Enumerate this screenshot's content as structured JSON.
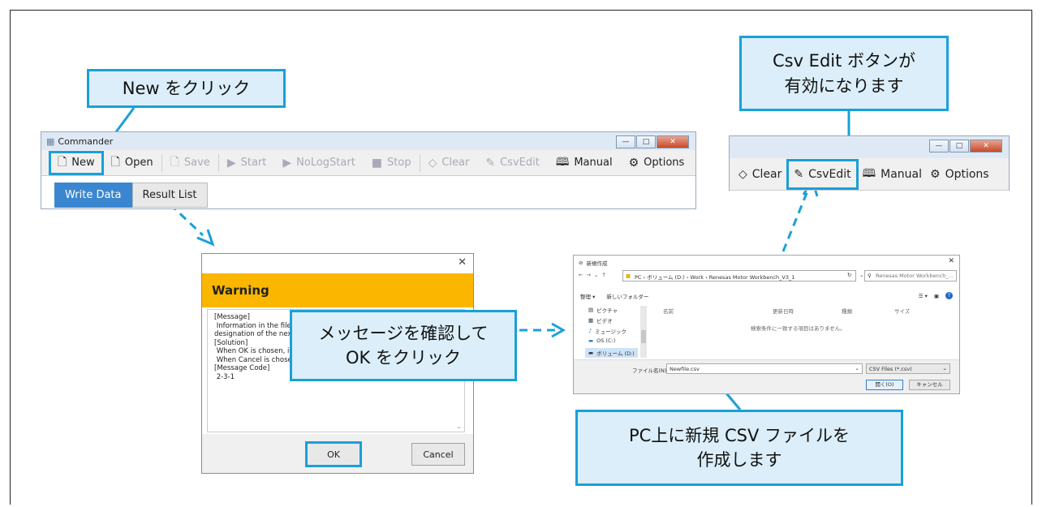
{
  "callouts": {
    "new_click": "New をクリック",
    "csvedit_enabled": "Csv Edit ボタンが\n有効になります",
    "confirm_ok": "メッセージを確認して\nOK をクリック",
    "create_csv": "PC上に新規 CSV ファイルを\n作成します"
  },
  "commander": {
    "title": "Commander",
    "toolbar": {
      "new": "New",
      "open": "Open",
      "save": "Save",
      "start": "Start",
      "nologstart": "NoLogStart",
      "stop": "Stop",
      "clear": "Clear",
      "csvedit": "CsvEdit",
      "manual": "Manual",
      "options": "Options"
    },
    "tabs": [
      "Write Data",
      "Result List"
    ]
  },
  "toolbar_zoom": {
    "clear": "Clear",
    "csvedit": "CsvEdit",
    "manual": "Manual",
    "options": "Options"
  },
  "warning_dialog": {
    "title": "Warning",
    "message": "[Message]\n Information in the file is cl\ndesignation of the next scr\n[Solution]\n When OK is chosen, it's po\n When Cancel is chosen, it'\n[Message Code]\n 2-3-1",
    "ok": "OK",
    "cancel": "Cancel"
  },
  "file_dialog": {
    "title": "新規作成",
    "breadcrumb": "PC › ボリューム (D:) › Work › Renesas Motor Workbench_V3_1",
    "search_placeholder": "Renesas Motor Workbench_...",
    "organize": "整理 ▾",
    "new_folder": "新しいフォルダー",
    "nav_items": [
      "ピクチャ",
      "ビデオ",
      "ミュージック",
      "OS (C:)",
      "ボリューム (D:)"
    ],
    "columns": [
      "名前",
      "更新日時",
      "種類",
      "サイズ"
    ],
    "empty_text": "検索条件に一致する項目はありません。",
    "filename_label": "ファイル名(N):",
    "filename_value": "Newfile.csv",
    "filetype": "CSV Files (*.csv)",
    "open_button": "開く(O)",
    "cancel_button": "キャンセル"
  },
  "colors": {
    "callout_border": "#1aa0d8",
    "callout_fill": "#dbeef9",
    "warning": "#fbb600",
    "tab_active": "#3b86d0"
  }
}
